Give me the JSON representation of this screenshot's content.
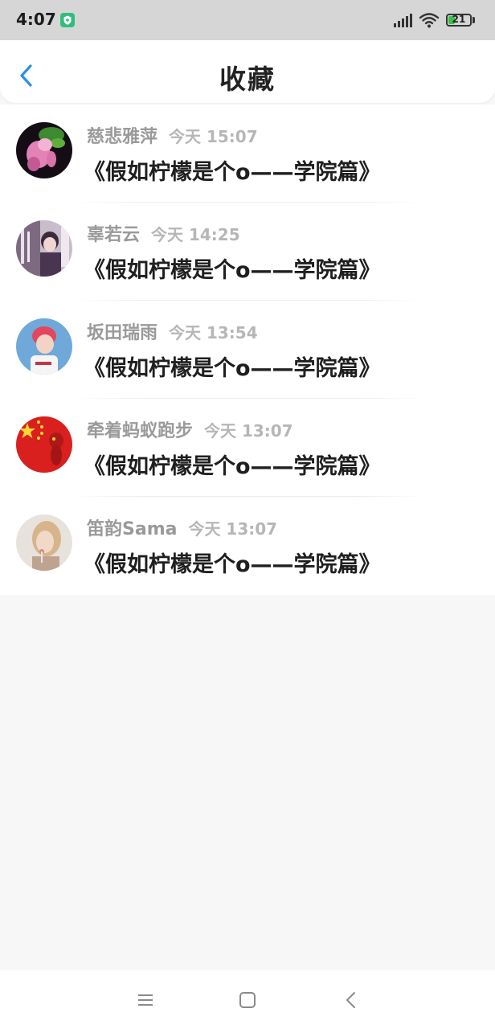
{
  "status_bar": {
    "time": "4:07",
    "battery_level": "21"
  },
  "header": {
    "title": "收藏"
  },
  "favorites": [
    {
      "username": "慈悲雅萍",
      "time": "今天 15:07",
      "title": "《假如柠檬是个o——学院篇》"
    },
    {
      "username": "辜若云",
      "time": "今天 14:25",
      "title": "《假如柠檬是个o——学院篇》"
    },
    {
      "username": "坂田瑞雨",
      "time": "今天 13:54",
      "title": "《假如柠檬是个o——学院篇》"
    },
    {
      "username": "牵着蚂蚁跑步",
      "time": "今天 13:07",
      "title": "《假如柠檬是个o——学院篇》"
    },
    {
      "username": "笛韵Sama",
      "time": "今天 13:07",
      "title": "《假如柠檬是个o——学院篇》"
    }
  ],
  "colors": {
    "accent": "#2b8fe8",
    "battery": "#3bbf4a"
  }
}
